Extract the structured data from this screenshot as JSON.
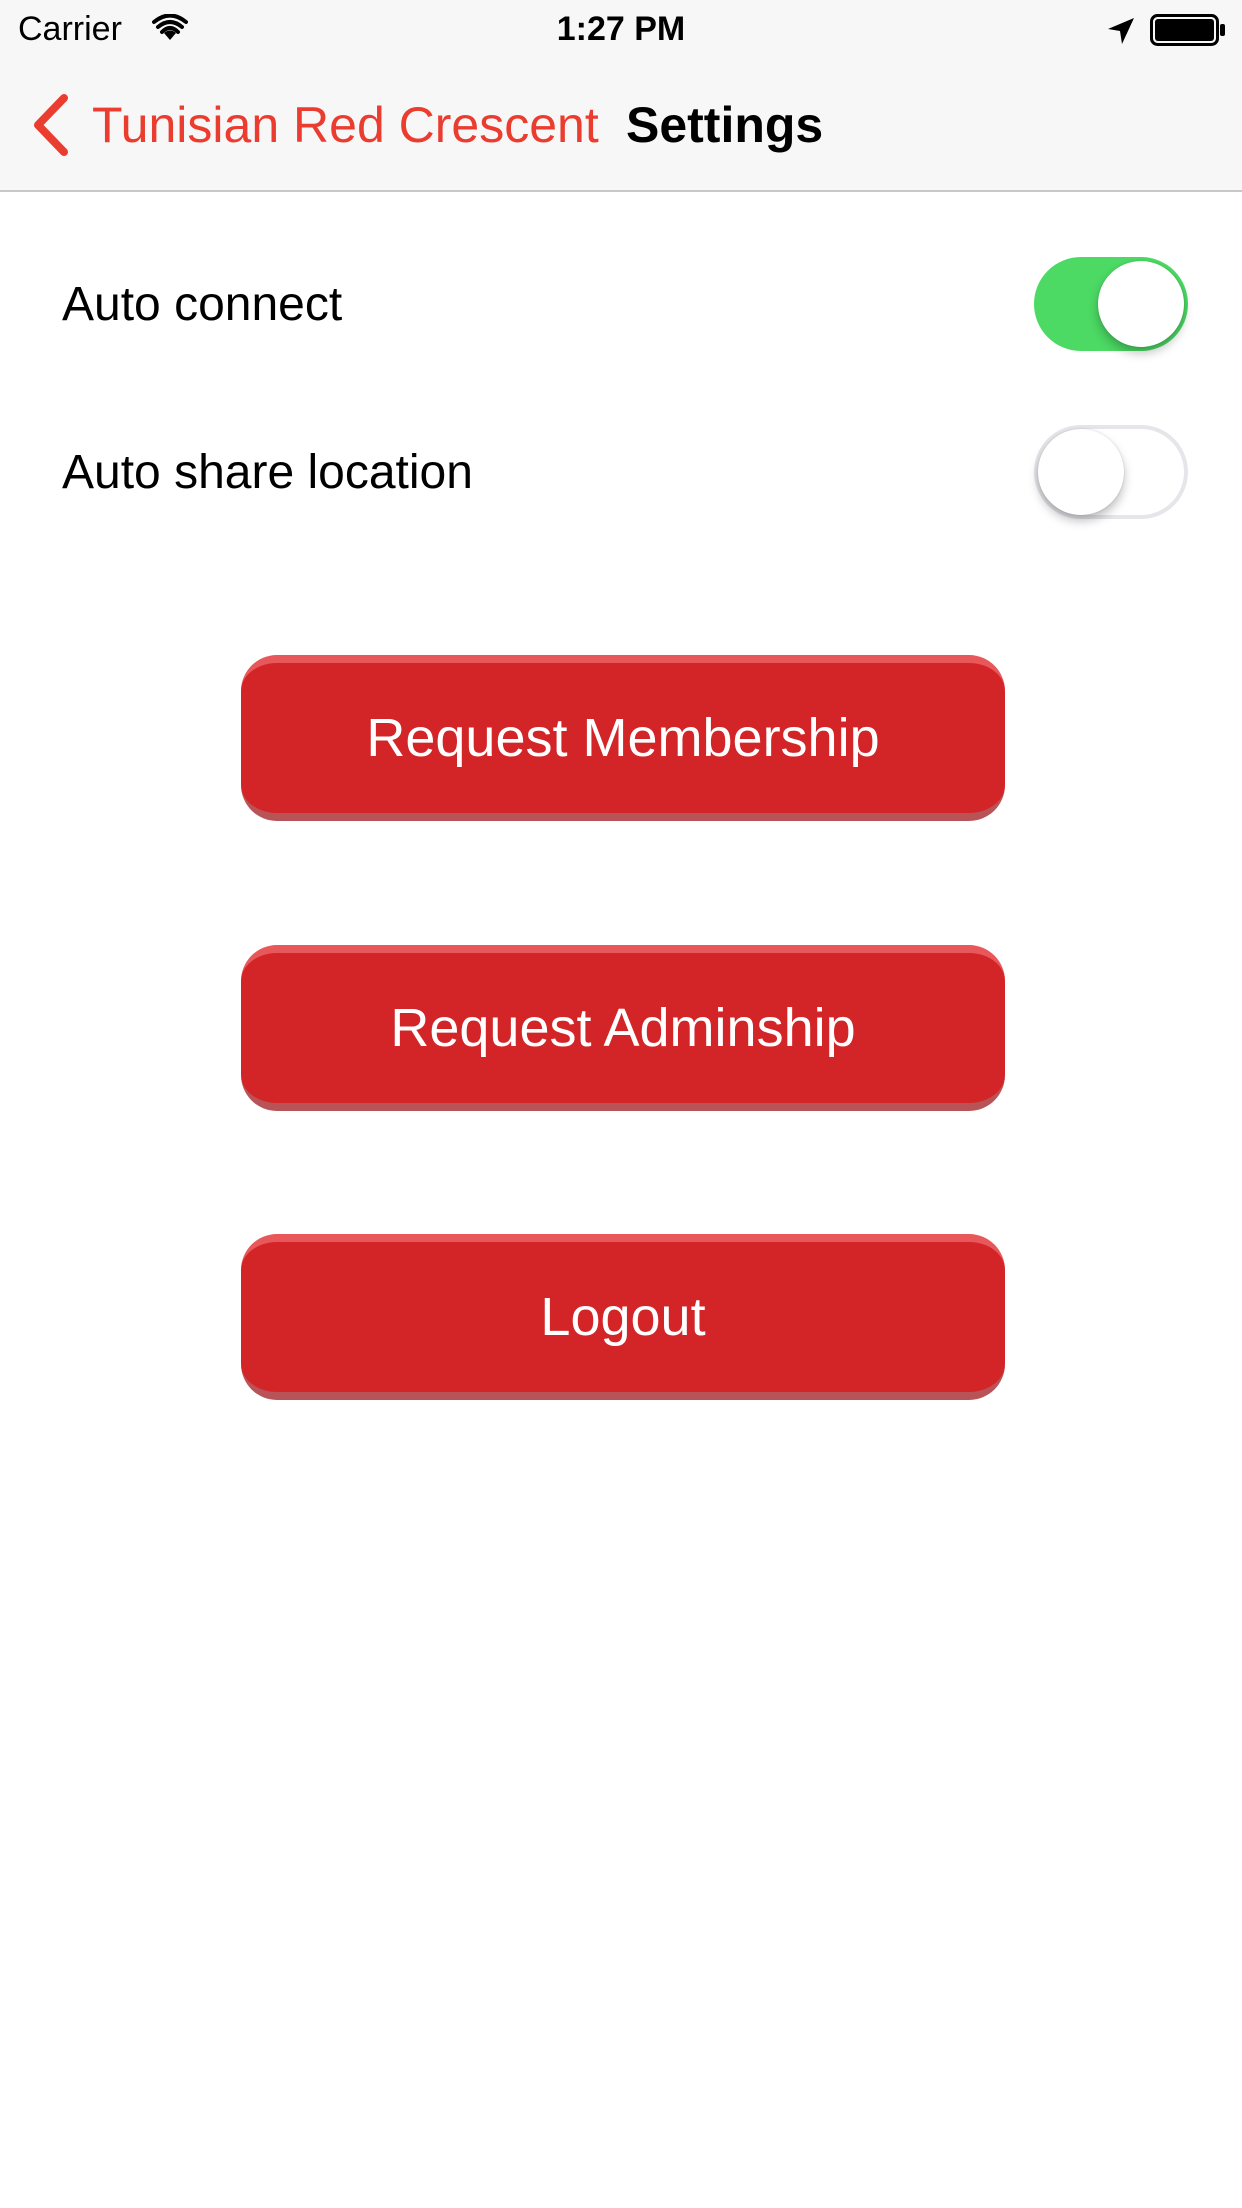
{
  "status_bar": {
    "carrier": "Carrier",
    "time": "1:27 PM",
    "icons": [
      "wifi-icon",
      "location-arrow-icon",
      "battery-icon"
    ]
  },
  "nav_bar": {
    "back_label": "Tunisian Red Crescent",
    "title": "Settings",
    "back_icon": "chevron-left-icon"
  },
  "settings": {
    "rows": [
      {
        "label": "Auto connect",
        "enabled": true
      },
      {
        "label": "Auto share location",
        "enabled": false
      }
    ]
  },
  "actions": {
    "buttons": [
      {
        "label": "Request Membership"
      },
      {
        "label": "Request Adminship"
      },
      {
        "label": "Logout"
      }
    ]
  },
  "colors": {
    "accent": "#ea3d2f",
    "button_red": "#d32528",
    "toggle_on": "#4cd964",
    "nav_background": "#f7f7f7"
  }
}
